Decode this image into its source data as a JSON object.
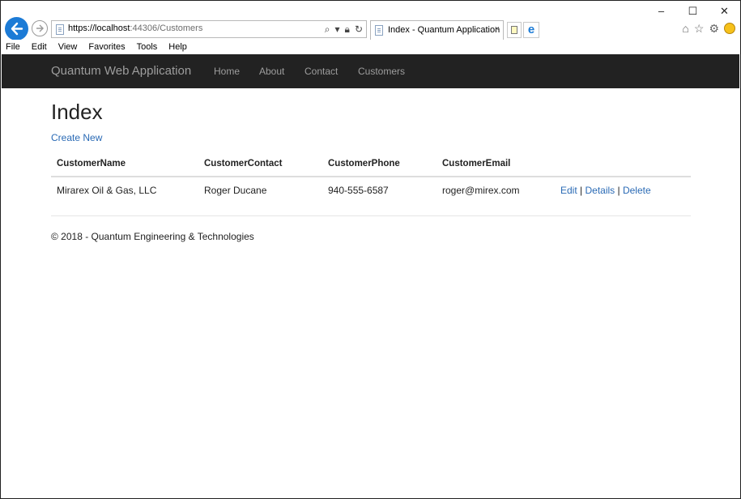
{
  "browser": {
    "url_scheme_host": "https://localhost",
    "url_port_path": ":44306/Customers",
    "tab_title": "Index - Quantum Application",
    "tab_close": "×",
    "menu": [
      "File",
      "Edit",
      "View",
      "Favorites",
      "Tools",
      "Help"
    ],
    "window_controls": {
      "minimize": "–",
      "maximize": "☐",
      "close": "✕"
    }
  },
  "navbar": {
    "brand": "Quantum Web Application",
    "links": [
      "Home",
      "About",
      "Contact",
      "Customers"
    ],
    "background": "#222222"
  },
  "page": {
    "title": "Index",
    "create_link": "Create New",
    "table": {
      "headers": [
        "CustomerName",
        "CustomerContact",
        "CustomerPhone",
        "CustomerEmail"
      ],
      "rows": [
        {
          "name": "Mirarex Oil & Gas, LLC",
          "contact": "Roger Ducane",
          "phone": "940-555-6587",
          "email": "roger@mirex.com",
          "actions": [
            "Edit",
            "Details",
            "Delete"
          ]
        }
      ]
    },
    "footer": "© 2018 - Quantum Engineering & Technologies"
  },
  "colors": {
    "link": "#2a6ab5",
    "nav_text": "#9d9d9d",
    "accent": "#1c7bd6"
  }
}
